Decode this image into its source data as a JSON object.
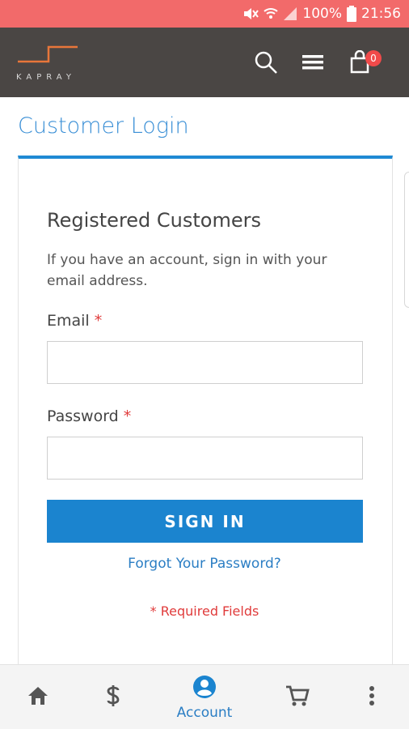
{
  "status_bar": {
    "battery": "100%",
    "time": "21:56"
  },
  "header": {
    "logo_text": "KAPRAY",
    "cart_count": "0"
  },
  "page": {
    "title": "Customer Login",
    "section_title": "Registered Customers",
    "intro": "If you have an account, sign in with your email address.",
    "email_label": "Email",
    "password_label": "Password",
    "required_mark": "*",
    "email_value": "",
    "password_value": "",
    "signin_label": "SIGN IN",
    "forgot_label": "Forgot Your Password?",
    "required_note": "* Required Fields"
  },
  "bottom_nav": {
    "account_label": "Account"
  },
  "colors": {
    "status_bar": "#f26a6a",
    "header": "#4a4644",
    "accent": "#1b84cf",
    "required": "#e03b3b"
  },
  "icons": [
    "mute-icon",
    "wifi-icon",
    "signal-icon",
    "battery-icon",
    "search-icon",
    "menu-icon",
    "cart-icon",
    "home-icon",
    "dollar-icon",
    "account-icon",
    "cart-icon",
    "more-icon"
  ]
}
